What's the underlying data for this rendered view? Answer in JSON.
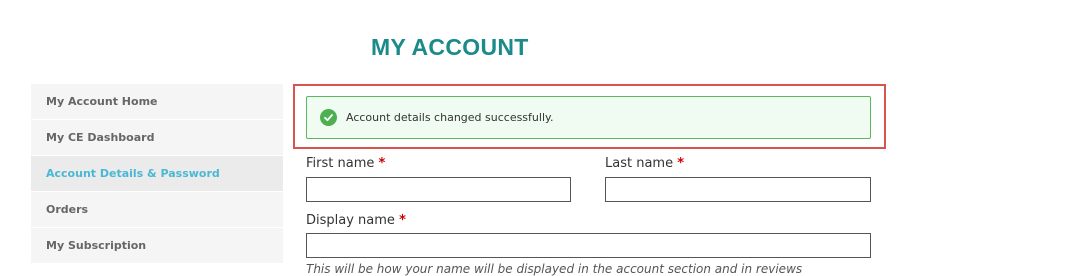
{
  "page": {
    "title": "MY ACCOUNT"
  },
  "sidebar": {
    "items": [
      {
        "label": "My Account Home",
        "active": false
      },
      {
        "label": "My CE Dashboard",
        "active": false
      },
      {
        "label": "Account Details & Password",
        "active": true
      },
      {
        "label": "Orders",
        "active": false
      },
      {
        "label": "My Subscription",
        "active": false
      }
    ]
  },
  "alert": {
    "icon": "check-circle-icon",
    "message": "Account details changed successfully."
  },
  "form": {
    "first_name": {
      "label": "First name",
      "required_marker": "*",
      "value": ""
    },
    "last_name": {
      "label": "Last name",
      "required_marker": "*",
      "value": ""
    },
    "display_name": {
      "label": "Display name",
      "required_marker": "*",
      "value": "",
      "hint": "This will be how your name will be displayed in the account section and in reviews"
    }
  },
  "colors": {
    "title": "#1a8a8a",
    "active_link": "#4ab8d4",
    "success_border": "#5cb85c",
    "success_bg": "#f0fbf2",
    "highlight_border": "#d9534f",
    "required": "#cc0000"
  }
}
